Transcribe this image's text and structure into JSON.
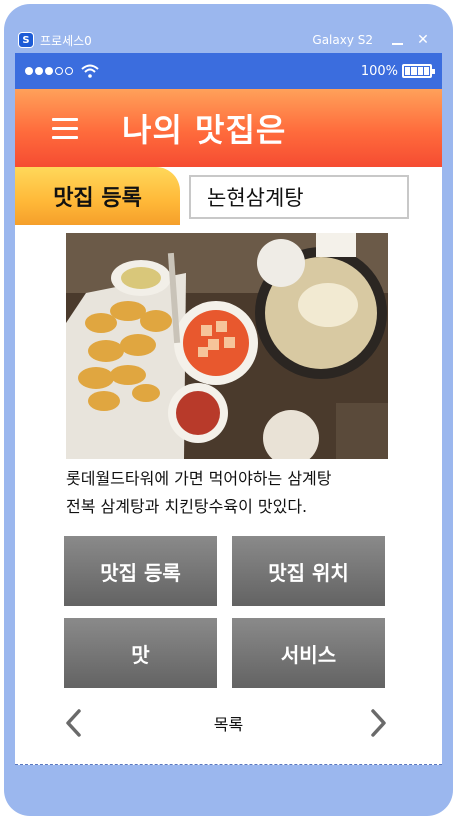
{
  "window": {
    "app_icon_letter": "S",
    "app_name": "프로세스0",
    "device_name": "Galaxy S2",
    "minimize_icon": "minimize-icon",
    "close_glyph": "✕"
  },
  "status": {
    "signal_bars_filled": 3,
    "signal_bars_total": 5,
    "battery": "100%"
  },
  "appbar": {
    "menu_icon": "hamburger-icon",
    "title": "나의 맛집은"
  },
  "register": {
    "label": "맛집 등록",
    "input_value": "논현삼계탕"
  },
  "photo": {
    "label": "food-photo"
  },
  "description": {
    "line1": "롯데월드타워에 가면 먹어야하는 삼계탕",
    "line2": "전복 삼계탕과 치킨탕수육이 맛있다."
  },
  "buttons": {
    "register": "맛집 등록",
    "location": "맛집 위치",
    "taste": "맛",
    "service": "서비스"
  },
  "pager": {
    "prev_icon": "chevron-left-icon",
    "label": "목록",
    "next_icon": "chevron-right-icon"
  },
  "colors": {
    "frame": "#9bb7ee",
    "statusbar": "#3b6dde",
    "appbar_accent": "#ff6b3c",
    "register_accent": "#ffb838",
    "button_gray": "#737373"
  }
}
